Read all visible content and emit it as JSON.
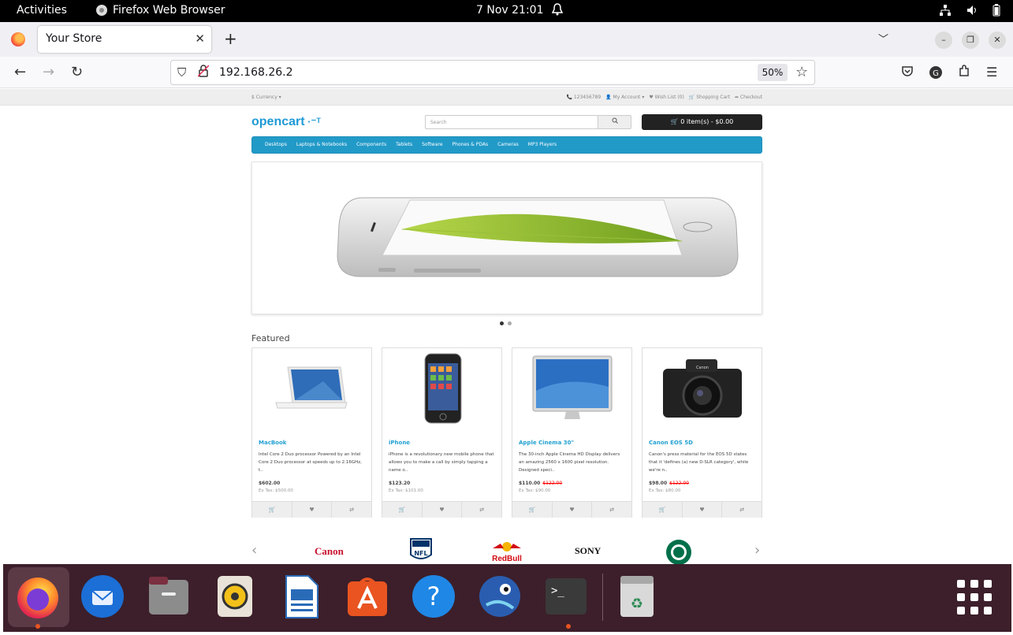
{
  "topbar": {
    "activities": "Activities",
    "app_name": "Firefox Web Browser",
    "clock": "7 Nov  21:01"
  },
  "browser": {
    "tab_title": "Your Store",
    "url": "192.168.26.2",
    "zoom": "50%"
  },
  "store": {
    "currency": "$ Currency ▾",
    "top_links": [
      "📞 123456789",
      "👤 My Account ▾",
      "♥ Wish List (0)",
      "🛒 Shopping Cart",
      "➦ Checkout"
    ],
    "logo": "opencart",
    "search_placeholder": "Search",
    "cart_button": "🛒 0 item(s) - $0.00",
    "menu": [
      "Desktops",
      "Laptops & Notebooks",
      "Components",
      "Tablets",
      "Software",
      "Phones & PDAs",
      "Cameras",
      "MP3 Players"
    ],
    "featured_heading": "Featured",
    "products": [
      {
        "name": "MacBook",
        "desc": "Intel Core 2 Duo processor Powered by an Intel Core 2 Duo processor at speeds up to 2.16GHz, t..",
        "price": "$602.00",
        "old_price": "",
        "tax": "Ex Tax: $500.00"
      },
      {
        "name": "iPhone",
        "desc": "iPhone is a revolutionary new mobile phone that allows you to make a call by simply tapping a name o..",
        "price": "$123.20",
        "old_price": "",
        "tax": "Ex Tax: $101.00"
      },
      {
        "name": "Apple Cinema 30\"",
        "desc": "The 30-inch Apple Cinema HD Display delivers an amazing 2560 x 1600 pixel resolution. Designed speci..",
        "price": "$110.00",
        "old_price": "$122.00",
        "tax": "Ex Tax: $90.00"
      },
      {
        "name": "Canon EOS 5D",
        "desc": "Canon's press material for the EOS 5D states that it 'defines (a) new D-SLR category', while we're n..",
        "price": "$98.00",
        "old_price": "$122.00",
        "tax": "Ex Tax: $80.00"
      }
    ],
    "brands": [
      "Canon",
      "NFL",
      "RedBull",
      "SONY",
      "STARBUCKS COFFEE"
    ]
  },
  "colors": {
    "accent": "#229ac8",
    "product_link": "#23a1d1",
    "dock_bg": "#3c1f2a",
    "ubuntu_orange": "#e95420"
  }
}
